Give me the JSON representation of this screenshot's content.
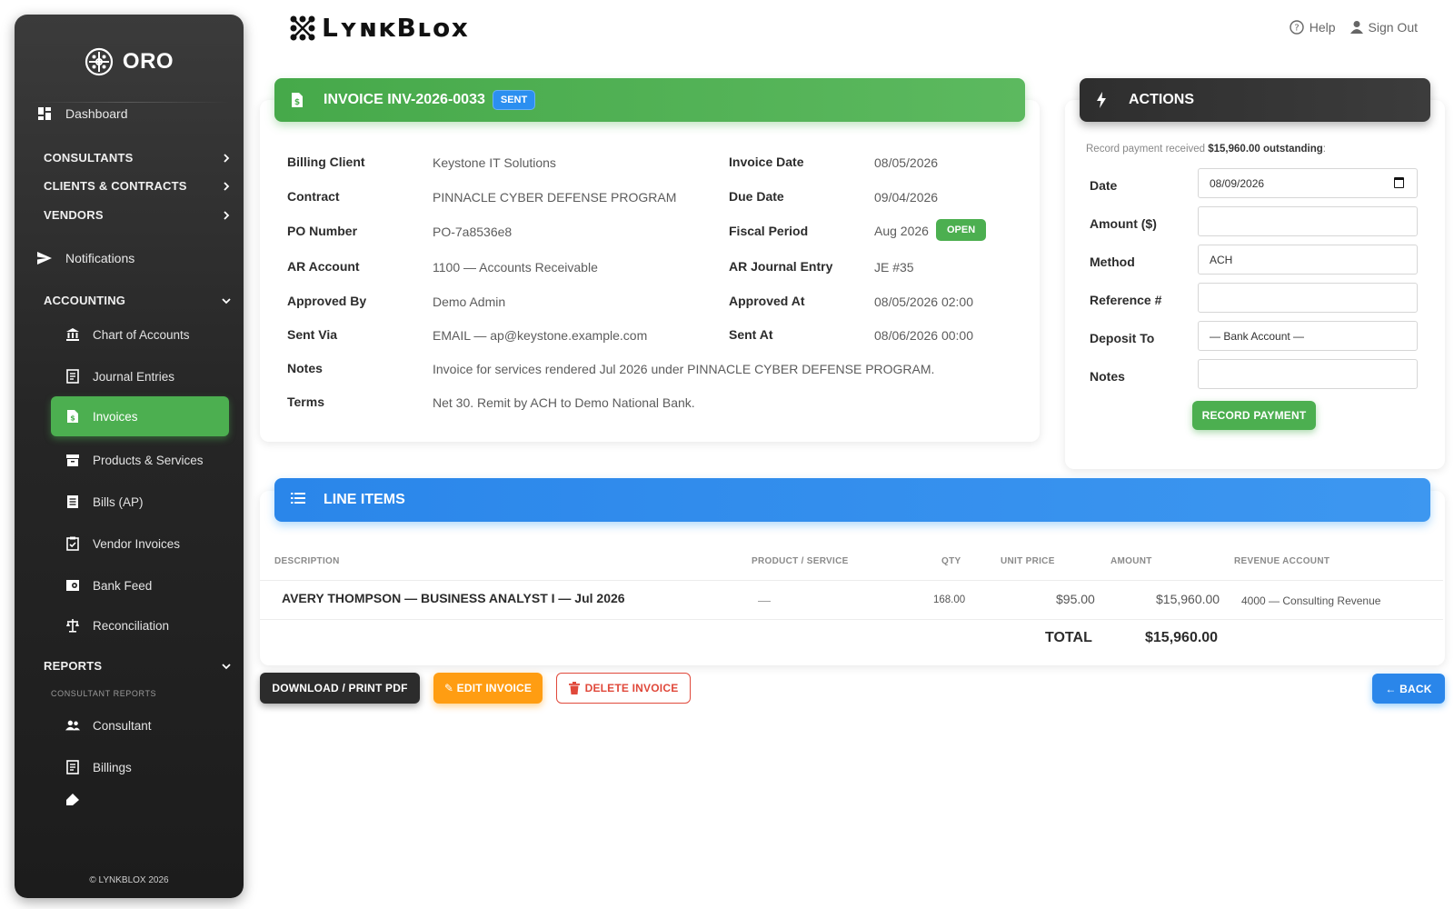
{
  "sidebar": {
    "brand": "ORO",
    "dashboard": "Dashboard",
    "sections": {
      "consultants": "CONSULTANTS",
      "clients": "CLIENTS & CONTRACTS",
      "vendors": "VENDORS",
      "accounting": "ACCOUNTING",
      "reports": "REPORTS"
    },
    "notifications": "Notifications",
    "accounting_items": [
      "Chart of Accounts",
      "Journal Entries",
      "Invoices",
      "Products & Services",
      "Bills (AP)",
      "Vendor Invoices",
      "Bank Feed",
      "Reconciliation"
    ],
    "consultant_reports_label": "CONSULTANT REPORTS",
    "report_items": [
      "Consultant",
      "Billings"
    ],
    "footer": "© LYNKBLOX 2026"
  },
  "topbar": {
    "logo_text": "LʏɴᴋBʟᴏx",
    "help": "Help",
    "sign_out": "Sign Out"
  },
  "invoice": {
    "title": "INVOICE INV-2026-0033",
    "status": "SENT",
    "left": [
      {
        "label": "Billing Client",
        "value": "Keystone IT Solutions"
      },
      {
        "label": "Contract",
        "value": "PINNACLE CYBER DEFENSE PROGRAM"
      },
      {
        "label": "PO Number",
        "value": "PO-7a8536e8"
      },
      {
        "label": "AR Account",
        "value": "1100 — Accounts Receivable"
      },
      {
        "label": "Approved By",
        "value": "Demo Admin"
      },
      {
        "label": "Sent Via",
        "value": "EMAIL — ap@keystone.example.com"
      }
    ],
    "right": [
      {
        "label": "Invoice Date",
        "value": "08/05/2026"
      },
      {
        "label": "Due Date",
        "value": "09/04/2026"
      },
      {
        "label": "Fiscal Period",
        "value": "Aug 2026"
      },
      {
        "label": "AR Journal Entry",
        "value": "JE #35"
      },
      {
        "label": "Approved At",
        "value": "08/05/2026 02:00"
      },
      {
        "label": "Sent At",
        "value": "08/06/2026 00:00"
      }
    ],
    "period_status": "OPEN",
    "notes_label": "Notes",
    "notes": "Invoice for services rendered Jul 2026 under PINNACLE CYBER DEFENSE PROGRAM.",
    "terms_label": "Terms",
    "terms": "Net 30. Remit by ACH to Demo National Bank."
  },
  "actions": {
    "title": "ACTIONS",
    "hint_prefix": "Record payment received",
    "hint_amount": "$15,960.00 outstanding",
    "hint_suffix": ":",
    "fields": {
      "date_label": "Date",
      "date_value": "08/09/2026",
      "amount_label": "Amount ($)",
      "amount_value": "",
      "method_label": "Method",
      "method_value": "ACH",
      "reference_label": "Reference #",
      "reference_value": "",
      "deposit_label": "Deposit To",
      "deposit_value": "— Bank Account —",
      "notes_label": "Notes",
      "notes_value": ""
    },
    "record_button": "RECORD PAYMENT"
  },
  "line_items": {
    "title": "LINE ITEMS",
    "headers": [
      "DESCRIPTION",
      "PRODUCT / SERVICE",
      "QTY",
      "UNIT PRICE",
      "AMOUNT",
      "REVENUE ACCOUNT"
    ],
    "rows": [
      {
        "description": "AVERY THOMPSON — BUSINESS ANALYST I — Jul 2026",
        "product": "—",
        "qty": "168.00",
        "unit_price": "$95.00",
        "amount": "$15,960.00",
        "revenue_account": "4000 — Consulting Revenue"
      }
    ],
    "total_label": "TOTAL",
    "total_value": "$15,960.00"
  },
  "buttons": {
    "download": " DOWNLOAD / PRINT PDF",
    "edit": "✎ EDIT INVOICE",
    "delete": "DELETE INVOICE",
    "back": "← BACK"
  },
  "colors": {
    "accent_green": "#4caf50",
    "accent_blue": "#2a86ea",
    "accent_orange": "#ff9d12",
    "danger": "#e0493b",
    "sidebar": "#262626"
  }
}
